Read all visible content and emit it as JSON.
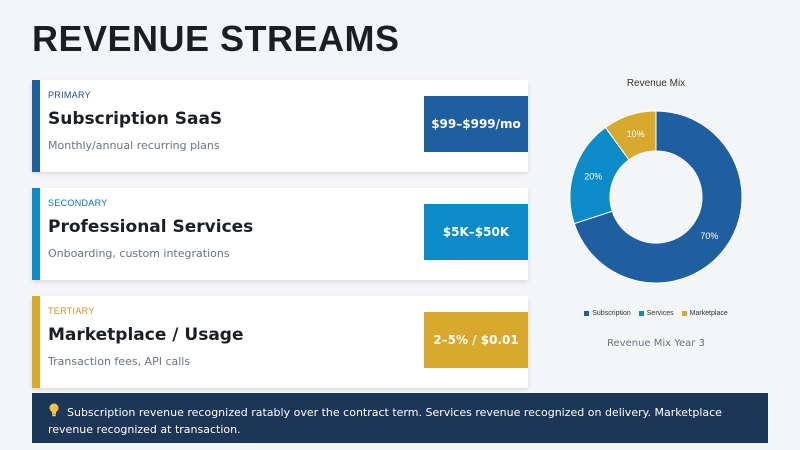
{
  "slide": {
    "title": "REVENUE STREAMS"
  },
  "streams": [
    {
      "tier": "PRIMARY",
      "name": "Subscription SaaS",
      "description": "Monthly/annual recurring plans",
      "price": "$99–$999/mo",
      "accent_color": "#1f5fa0",
      "tier_color": "#1f4e8c",
      "price_bg": "#1f5fa0"
    },
    {
      "tier": "SECONDARY",
      "name": "Professional Services",
      "description": "Onboarding, custom integrations",
      "price": "$5K–$50K",
      "accent_color": "#0b8bc7",
      "tier_color": "#0b72a8",
      "price_bg": "#0b8bc7"
    },
    {
      "tier": "TERTIARY",
      "name": "Marketplace / Usage",
      "description": "Transaction fees, API calls",
      "price": "2–5% / $0.01",
      "accent_color": "#d9a92e",
      "tier_color": "#c8961f",
      "price_bg": "#d9a92e"
    }
  ],
  "chart_data": {
    "type": "pie",
    "title": "Revenue Mix",
    "caption": "Revenue Mix Year 3",
    "categories": [
      "Subscription",
      "Services",
      "Marketplace"
    ],
    "values": [
      70,
      20,
      10
    ],
    "labels": [
      "70%",
      "20%",
      "10%"
    ],
    "colors": [
      "#1f5fa0",
      "#0b8bc7",
      "#d9a92e"
    ],
    "donut": true,
    "legend_position": "bottom"
  },
  "banner": {
    "icon": "lightbulb-icon",
    "text": "Subscription revenue recognized ratably over the contract term. Services revenue recognized on delivery. Marketplace revenue recognized at transaction."
  }
}
